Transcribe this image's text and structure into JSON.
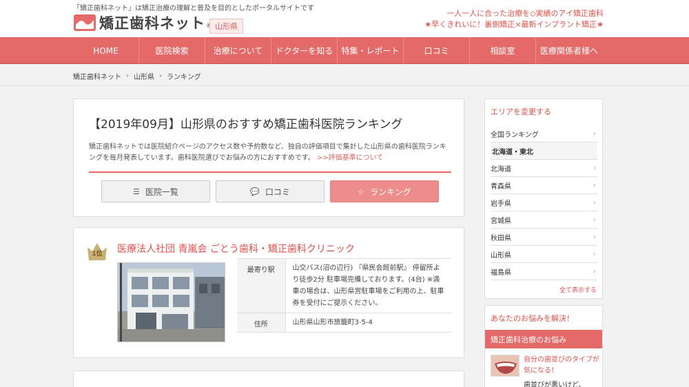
{
  "header": {
    "tagline": "「矯正歯科ネット」は矯正治療の理解と普及を目的としたポータルサイトです",
    "logo_text": "矯正歯科ネット",
    "logo_reg": "®",
    "prefecture": "山形県",
    "promo_1": "一人一人に合った治療を◇実績のアイ矯正歯科",
    "promo_2": "★早くきれいに！裏側矯正×最新インプラント矯正★"
  },
  "nav": [
    {
      "label": "HOME"
    },
    {
      "label": "医院検索"
    },
    {
      "label": "治療について"
    },
    {
      "label": "ドクターを知る"
    },
    {
      "label": "特集・レポート"
    },
    {
      "label": "口コミ"
    },
    {
      "label": "相談室"
    },
    {
      "label": "医療関係者様へ"
    }
  ],
  "breadcrumb": [
    "矯正歯科ネット",
    "山形県",
    "ランキング"
  ],
  "breadcrumb_sep": "›",
  "main": {
    "title": "【2019年09月】山形県のおすすめ矯正歯科医院ランキング",
    "intro": "矯正歯科ネットでは医院紹介ページのアクセス数や予約数など、独自の評価項目で集計した山形県の歯科医院ランキングを毎月発表しています。歯科医院選びでお悩みの方におすすめです。",
    "intro_link": ">>評価基準について",
    "tabs": [
      {
        "label": "医院一覧",
        "icon": "☰"
      },
      {
        "label": "口コミ",
        "icon": "💬"
      },
      {
        "label": "ランキング",
        "icon": "☆"
      }
    ]
  },
  "rank1": {
    "rank_label": "1位",
    "clinic_name": "医療法人社団 青嵐会 ごとう歯科・矯正歯科クリニック",
    "station_label": "最寄り駅",
    "station_value": "山交バス(沼の辺行) 『県民会館前駅』 停留所より徒歩2分 駐車場完備しております。(4台) ※満車の場合は、山形県営駐車場をご利用の上、駐車券を受付にご提示ください。",
    "address_label": "住所",
    "address_value": "山形県山形市旅籠町3-5-4"
  },
  "sidebar": {
    "area_head": "エリアを変更する",
    "areas": [
      {
        "label": "全国ランキング",
        "group": false
      },
      {
        "label": "北海道・東北",
        "group": true
      },
      {
        "label": "北海道",
        "group": false
      },
      {
        "label": "青森県",
        "group": false
      },
      {
        "label": "岩手県",
        "group": false
      },
      {
        "label": "宮城県",
        "group": false
      },
      {
        "label": "秋田県",
        "group": false
      },
      {
        "label": "山形県",
        "group": false
      },
      {
        "label": "福島県",
        "group": false
      }
    ],
    "chevron": "›",
    "show_all": "全て表示する",
    "worry_head": "あなたのお悩みを解決！",
    "worry_bar": "矯正歯科治療のお悩み",
    "worry_link": "自分の歯並びのタイプが気になる！",
    "worry_sub": "歯並びが悪いけど、"
  },
  "colors": {
    "accent": "#e36a68",
    "accent_text": "#e0504a",
    "tab_active": "#ec8d8b"
  }
}
